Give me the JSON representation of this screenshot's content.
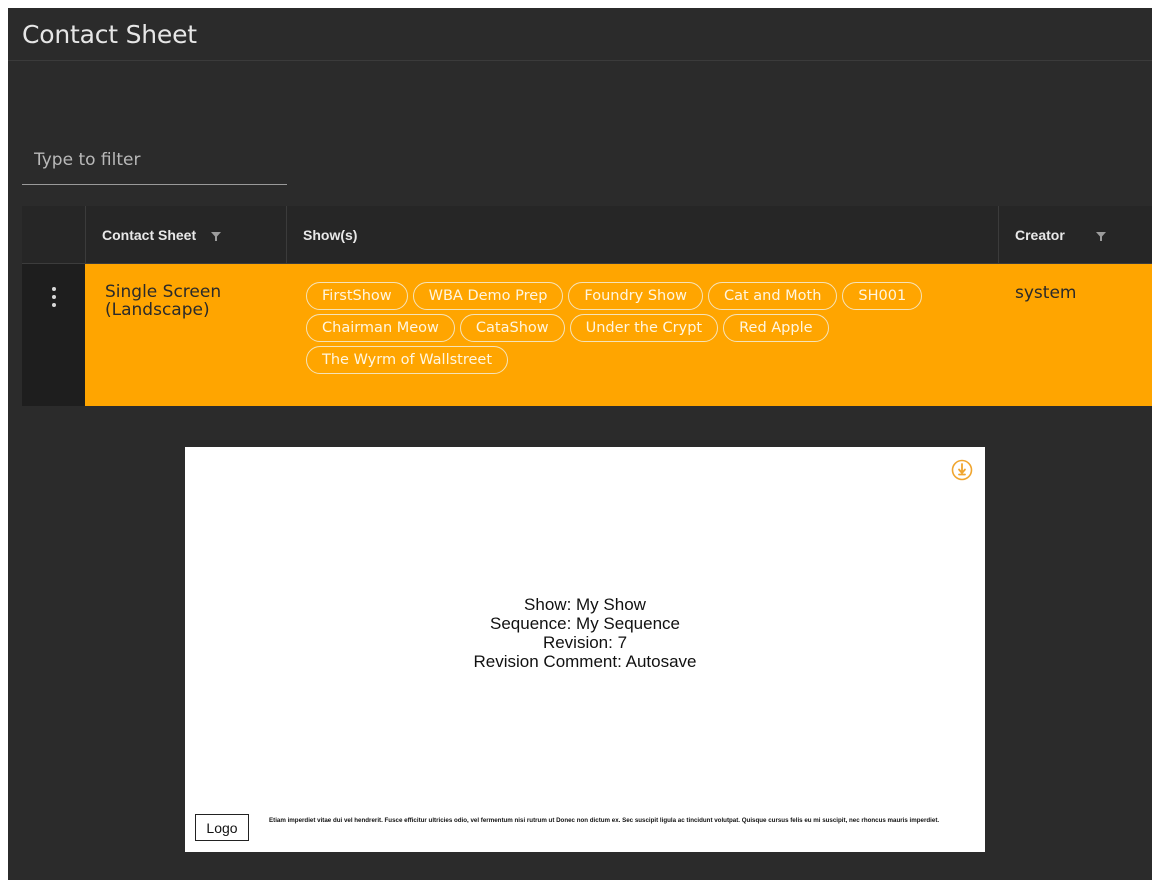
{
  "header": {
    "title": "Contact Sheet"
  },
  "filter": {
    "placeholder": "Type to filter",
    "value": ""
  },
  "table": {
    "columns": [
      {
        "label": "Contact Sheet",
        "filterable": true
      },
      {
        "label": "Show(s)",
        "filterable": false
      },
      {
        "label": "Creator",
        "filterable": true
      }
    ],
    "rows": [
      {
        "contact_sheet": "Single Screen (Landscape)",
        "shows": [
          "FirstShow",
          "WBA Demo Prep",
          "Foundry Show",
          "Cat and Moth",
          "SH001",
          "Chairman Meow",
          "CataShow",
          "Under the Crypt",
          "Red Apple",
          "The Wyrm of Wallstreet"
        ],
        "creator": "system",
        "menu_icon": "kebab-menu-icon"
      }
    ]
  },
  "preview": {
    "lines": [
      "Show: My Show",
      "Sequence: My Sequence",
      "Revision: 7",
      "Revision Comment: Autosave"
    ],
    "logo_label": "Logo",
    "footer_text": "Etiam imperdiet vitae dui vel hendrerit. Fusce efficitur ultricies odio, vel fermentum nisi rutrum ut Donec non dictum ex. Sec suscipit ligula ac tincidunt volutpat. Quisque cursus felis eu mi suscipit, nec rhoncus mauris imperdiet.",
    "pin_icon": "pin-icon"
  },
  "colors": {
    "background": "#2b2b2b",
    "accent": "#ffa500",
    "chip_border": "#f5e3b8",
    "text_light": "#e6e6e6"
  }
}
